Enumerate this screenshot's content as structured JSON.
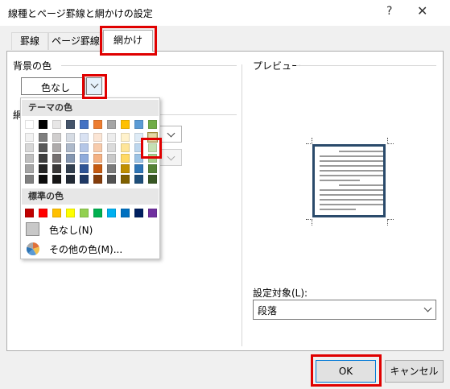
{
  "window": {
    "title": "線種とページ罫線と網かけの設定",
    "help": "?",
    "close": "✕"
  },
  "tabs": [
    {
      "label": "罫線",
      "active": false
    },
    {
      "label": "ページ罫線",
      "active": false
    },
    {
      "label": "網かけ",
      "active": true
    }
  ],
  "left": {
    "background_label": "背景の色",
    "fill_value": "色なし",
    "pattern_label_partial": "網"
  },
  "dropdown": {
    "theme_header": "テーマの色",
    "standard_header": "標準の色",
    "no_color_label": "色なし(N)",
    "more_colors_label": "その他の色(M)...",
    "theme_top_row": [
      "#ffffff",
      "#000000",
      "#e7e6e6",
      "#44546a",
      "#4472c4",
      "#ed7d31",
      "#a5a5a5",
      "#ffc000",
      "#5b9bd5",
      "#70ad47"
    ],
    "theme_shades": [
      [
        "#f2f2f2",
        "#7f7f7f",
        "#d0cece",
        "#d6dce4",
        "#d9e2f3",
        "#fbe5d5",
        "#ededed",
        "#fff2cc",
        "#deebf6",
        "#e2efd9"
      ],
      [
        "#d8d8d8",
        "#595959",
        "#aeabab",
        "#adb9ca",
        "#b4c6e7",
        "#f7cbac",
        "#dbdbdb",
        "#fee599",
        "#bdd7ee",
        "#c5e0b3"
      ],
      [
        "#bfbfbf",
        "#3f3f3f",
        "#757070",
        "#8496b0",
        "#8eaadb",
        "#f4b183",
        "#c9c9c9",
        "#ffd965",
        "#9cc3e5",
        "#a8d08d"
      ],
      [
        "#a5a5a5",
        "#262626",
        "#3a3838",
        "#323f4f",
        "#2f5496",
        "#c55a11",
        "#7b7b7b",
        "#bf8f00",
        "#2e75b5",
        "#538135"
      ],
      [
        "#7f7f7f",
        "#0c0c0c",
        "#171616",
        "#222a35",
        "#1f3864",
        "#833c0b",
        "#525252",
        "#7f6000",
        "#1e4e79",
        "#375623"
      ]
    ],
    "standard_colors": [
      "#c00000",
      "#ff0000",
      "#ffc000",
      "#ffff00",
      "#92d050",
      "#00b050",
      "#00b0f0",
      "#0070c0",
      "#002060",
      "#7030a0"
    ],
    "selected_color": "#e4d9a4"
  },
  "preview": {
    "label": "プレビュー",
    "apply_to_label": "設定対象(L):",
    "apply_to_value": "段落"
  },
  "buttons": {
    "ok": "OK",
    "cancel": "キャンセル"
  },
  "colors": {
    "highlight_red": "#e00000",
    "preview_border": "#2a4a6b"
  }
}
